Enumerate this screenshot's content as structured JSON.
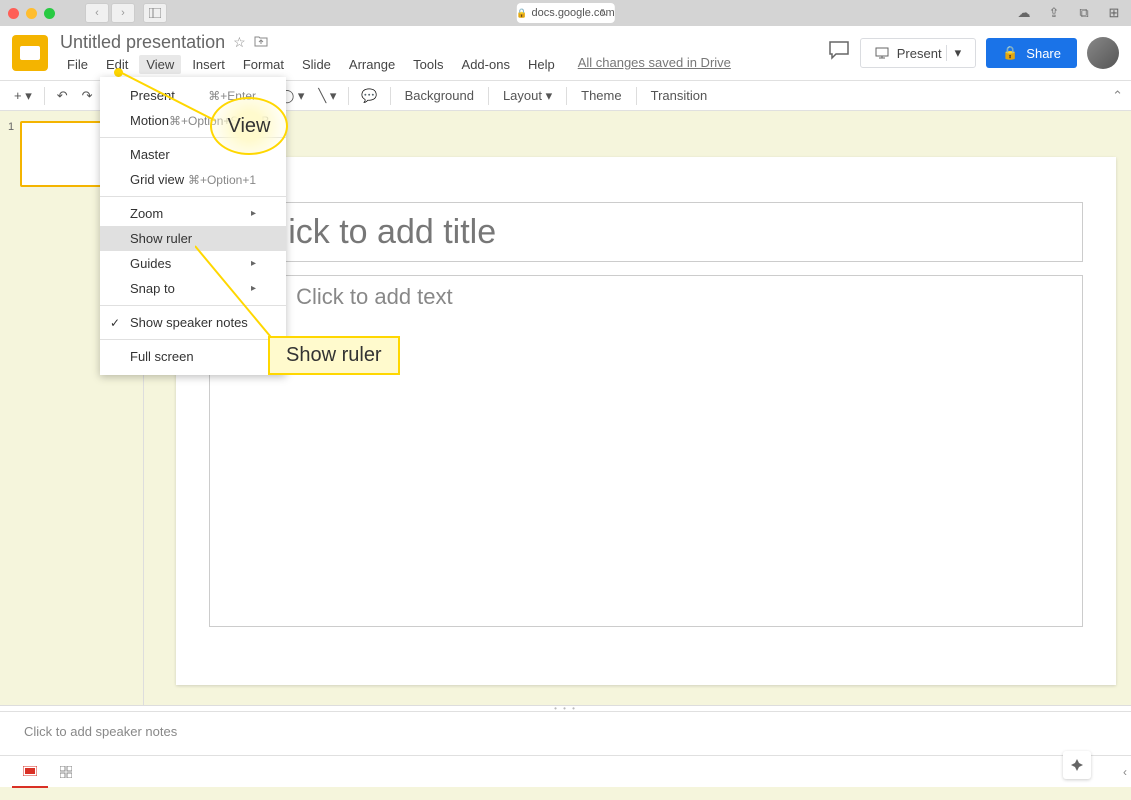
{
  "browser": {
    "url": "docs.google.com"
  },
  "doc": {
    "title": "Untitled presentation",
    "save_status": "All changes saved in Drive"
  },
  "menu_bar": {
    "items": [
      "File",
      "Edit",
      "View",
      "Insert",
      "Format",
      "Slide",
      "Arrange",
      "Tools",
      "Add-ons",
      "Help"
    ]
  },
  "header_buttons": {
    "present": "Present",
    "share": "Share"
  },
  "toolbar": {
    "background": "Background",
    "layout": "Layout",
    "theme": "Theme",
    "transition": "Transition"
  },
  "slide_panel": {
    "slide_number": "1"
  },
  "canvas": {
    "title_placeholder": "Click to add title",
    "subtitle_placeholder": "Click to add text"
  },
  "view_menu": {
    "present": "Present",
    "present_shortcut": "⌘+Enter",
    "motion": "Motion",
    "motion_shortcut": "⌘+Option+Shift+B",
    "master": "Master",
    "grid_view": "Grid view",
    "grid_view_shortcut": "⌘+Option+1",
    "zoom": "Zoom",
    "show_ruler": "Show ruler",
    "guides": "Guides",
    "snap_to": "Snap to",
    "show_speaker_notes": "Show speaker notes",
    "full_screen": "Full screen"
  },
  "callouts": {
    "view": "View",
    "show_ruler": "Show ruler"
  },
  "speaker_notes": {
    "placeholder": "Click to add speaker notes"
  }
}
